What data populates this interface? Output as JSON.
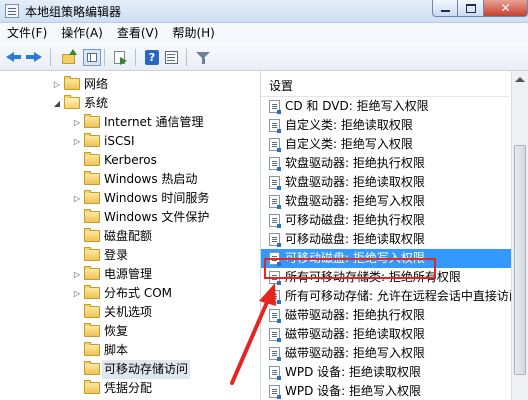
{
  "window": {
    "title": "本地组策略编辑器"
  },
  "menu": [
    "文件(F)",
    "操作(A)",
    "查看(V)",
    "帮助(H)"
  ],
  "toolbar": [
    "back-icon",
    "forward-icon",
    "up-icon",
    "show-hide-tree-icon",
    "export-icon",
    "help-icon",
    "properties-icon",
    "filter-icon"
  ],
  "tree": {
    "items": [
      {
        "label": "网络",
        "level": 0,
        "expander": "collapsed"
      },
      {
        "label": "系统",
        "level": 0,
        "expander": "expanded"
      },
      {
        "label": "Internet 通信管理",
        "level": 1,
        "expander": "collapsed"
      },
      {
        "label": "iSCSI",
        "level": 1,
        "expander": "collapsed"
      },
      {
        "label": "Kerberos",
        "level": 1,
        "expander": "none"
      },
      {
        "label": "Windows 热启动",
        "level": 1,
        "expander": "none"
      },
      {
        "label": "Windows 时间服务",
        "level": 1,
        "expander": "collapsed"
      },
      {
        "label": "Windows 文件保护",
        "level": 1,
        "expander": "none"
      },
      {
        "label": "磁盘配额",
        "level": 1,
        "expander": "none"
      },
      {
        "label": "登录",
        "level": 1,
        "expander": "none"
      },
      {
        "label": "电源管理",
        "level": 1,
        "expander": "collapsed"
      },
      {
        "label": "分布式 COM",
        "level": 1,
        "expander": "collapsed"
      },
      {
        "label": "关机选项",
        "level": 1,
        "expander": "none"
      },
      {
        "label": "恢复",
        "level": 1,
        "expander": "none"
      },
      {
        "label": "脚本",
        "level": 1,
        "expander": "none"
      },
      {
        "label": "可移动存储访问",
        "level": 1,
        "expander": "none",
        "selected": true
      },
      {
        "label": "凭据分配",
        "level": 1,
        "expander": "none"
      }
    ]
  },
  "details": {
    "column_header": "设置",
    "rows": [
      {
        "label": "CD 和 DVD: 拒绝写入权限"
      },
      {
        "label": "自定义类: 拒绝读取权限"
      },
      {
        "label": "自定义类: 拒绝写入权限"
      },
      {
        "label": "软盘驱动器: 拒绝执行权限"
      },
      {
        "label": "软盘驱动器: 拒绝读取权限"
      },
      {
        "label": "软盘驱动器: 拒绝写入权限"
      },
      {
        "label": "可移动磁盘: 拒绝执行权限"
      },
      {
        "label": "可移动磁盘: 拒绝读取权限"
      },
      {
        "label": "可移动磁盘: 拒绝写入权限",
        "selected": true
      },
      {
        "label": "所有可移动存储类: 拒绝所有权限"
      },
      {
        "label": "所有可移动存储: 允许在远程会话中直接访问"
      },
      {
        "label": "磁带驱动器: 拒绝执行权限"
      },
      {
        "label": "磁带驱动器: 拒绝读取权限"
      },
      {
        "label": "磁带驱动器: 拒绝写入权限"
      },
      {
        "label": "WPD 设备: 拒绝读取权限"
      },
      {
        "label": "WPD 设备: 拒绝写入权限"
      }
    ]
  },
  "colors": {
    "selection": "#3399ff",
    "annotation": "#e52620",
    "folder": "#efc353"
  }
}
